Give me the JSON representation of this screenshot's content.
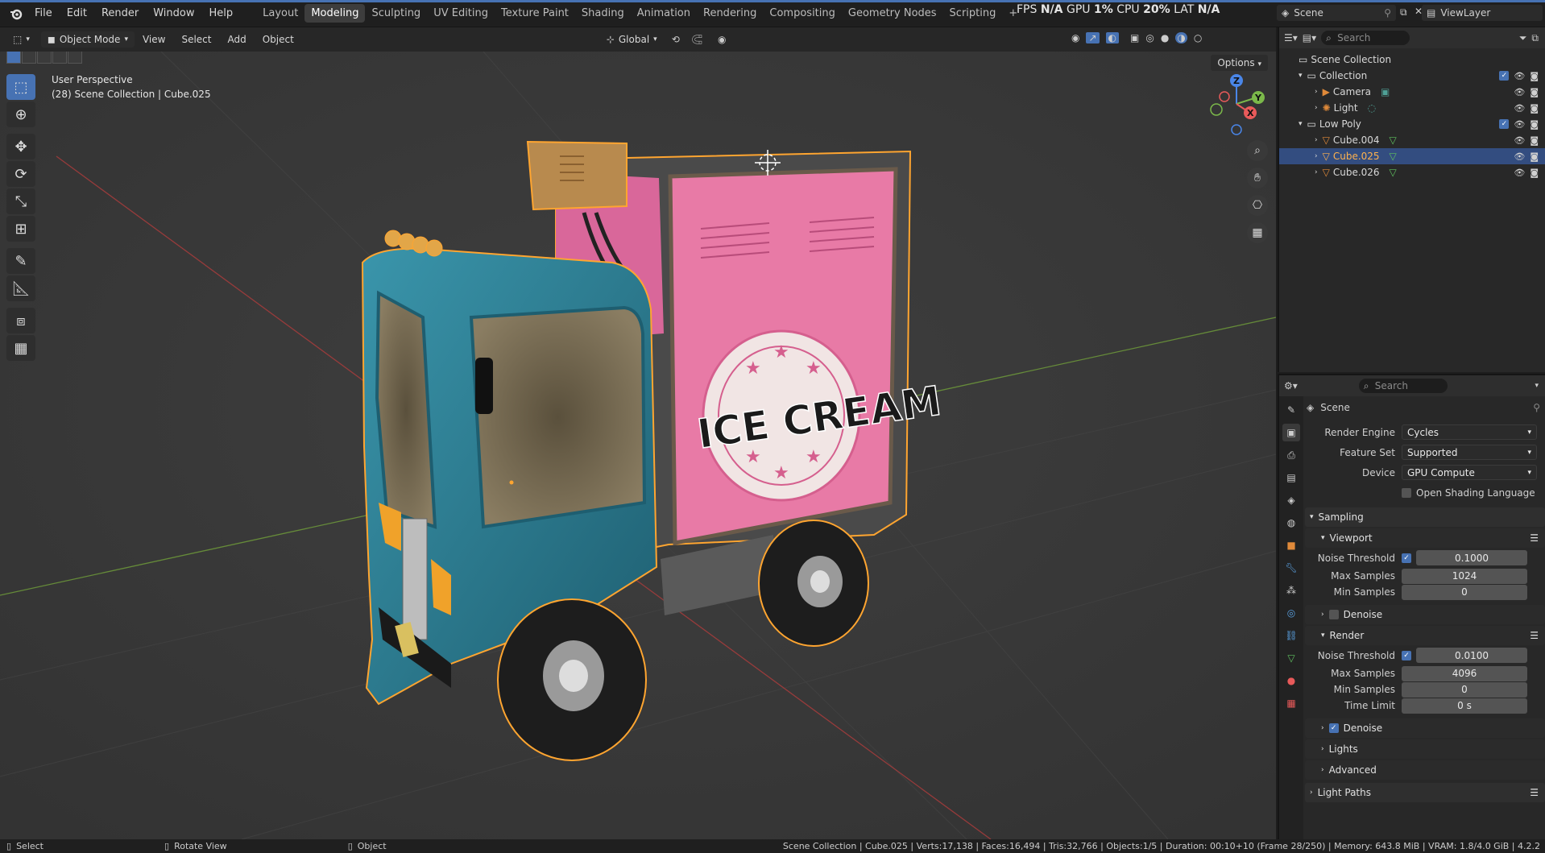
{
  "menu": {
    "items": [
      "File",
      "Edit",
      "Render",
      "Window",
      "Help"
    ]
  },
  "workspaces": [
    "Layout",
    "Modeling",
    "Sculpting",
    "UV Editing",
    "Texture Paint",
    "Shading",
    "Animation",
    "Rendering",
    "Compositing",
    "Geometry Nodes",
    "Scripting"
  ],
  "workspace_add": "+",
  "stats": {
    "fps_label": "FPS",
    "fps_value": "N/A",
    "gpu_label": "GPU",
    "gpu_value": "1%",
    "cpu_label": "CPU",
    "cpu_value": "20%",
    "lat_label": "LAT",
    "lat_value": "N/A"
  },
  "scene_name": "Scene",
  "view_layer": "ViewLayer",
  "viewport_header": {
    "mode": "Object Mode",
    "menus": [
      "View",
      "Select",
      "Add",
      "Object"
    ],
    "transform": "Global",
    "options": "Options"
  },
  "viewport_info": {
    "line1": "User Perspective",
    "line2": "(28) Scene Collection | Cube.025"
  },
  "gizmo": {
    "x": "X",
    "y": "Y",
    "z": "Z"
  },
  "truck_text": "ICE CREAM",
  "outliner": {
    "search_placeholder": "Search",
    "rows": [
      {
        "label": "Scene Collection"
      },
      {
        "label": "Collection"
      },
      {
        "label": "Camera"
      },
      {
        "label": "Light"
      },
      {
        "label": "Low Poly"
      },
      {
        "label": "Cube.004"
      },
      {
        "label": "Cube.025"
      },
      {
        "label": "Cube.026"
      }
    ]
  },
  "properties": {
    "search_placeholder": "Search",
    "context": "Scene",
    "render_engine_label": "Render Engine",
    "render_engine": "Cycles",
    "feature_set_label": "Feature Set",
    "feature_set": "Supported",
    "device_label": "Device",
    "device": "GPU Compute",
    "osl_label": "Open Shading Language",
    "sampling": "Sampling",
    "viewport": "Viewport",
    "noise_threshold_label": "Noise Threshold",
    "vp_noise": "0.1000",
    "max_samples_label": "Max Samples",
    "vp_max": "1024",
    "min_samples_label": "Min Samples",
    "vp_min": "0",
    "denoise_label": "Denoise",
    "render": "Render",
    "r_noise": "0.0100",
    "r_max": "4096",
    "r_min": "0",
    "time_limit_label": "Time Limit",
    "r_time": "0 s",
    "lights": "Lights",
    "advanced": "Advanced",
    "light_paths": "Light Paths"
  },
  "statusbar": {
    "select": "Select",
    "rotate": "Rotate View",
    "object": "Object",
    "info": "Scene Collection | Cube.025 | Verts:17,138 | Faces:16,494 | Tris:32,766 | Objects:1/5 | Duration: 00:10+10 (Frame 28/250) | Memory: 643.8 MiB | VRAM: 1.8/4.0 GiB | 4.2.2"
  },
  "colors": {
    "accent": "#4772b3",
    "selection_outline": "#ffa530",
    "truck_blue": "#2a7d92",
    "truck_pink": "#e87aa6"
  }
}
